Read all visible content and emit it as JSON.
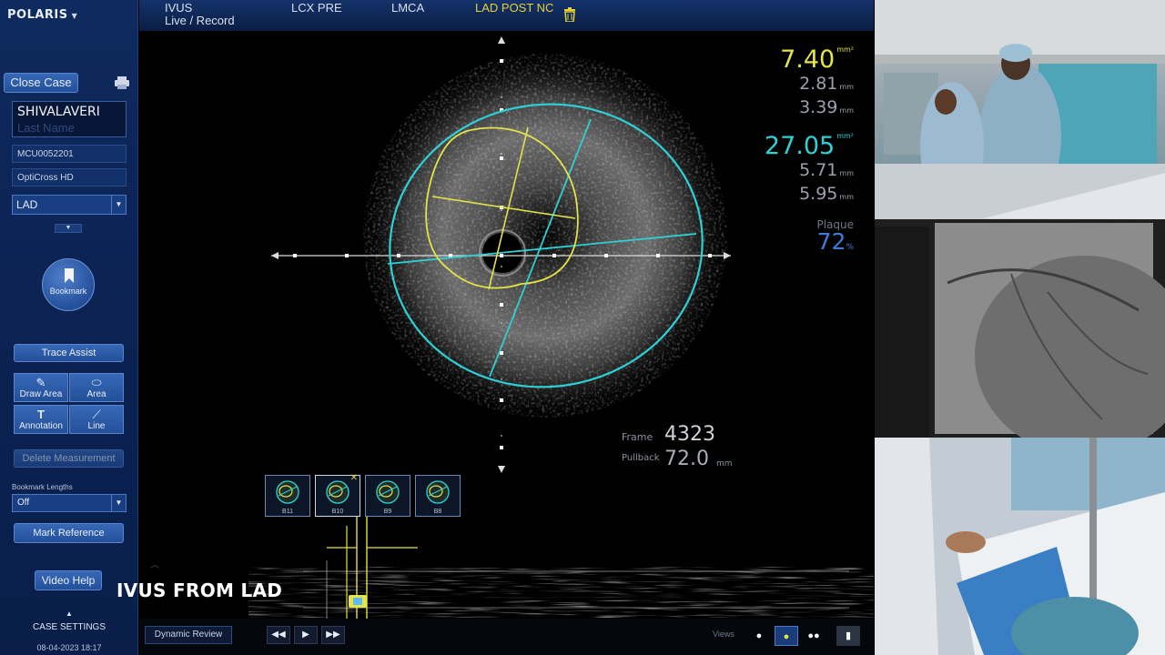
{
  "sidebar": {
    "brand": "POLARIS",
    "close_case": "Close Case",
    "patient_first": "SHIVALAVERI",
    "patient_last_placeholder": "Last Name",
    "patient_id": "MCU0052201",
    "catheter": "OptiCross HD",
    "vessel": "LAD",
    "bookmark": "Bookmark",
    "trace_assist": "Trace Assist",
    "tools": {
      "draw_area": "Draw Area",
      "area": "Area",
      "annotation": "Annotation",
      "line": "Line"
    },
    "delete_measurement": "Delete Measurement",
    "bookmark_lengths_label": "Bookmark Lengths",
    "bookmark_lengths_value": "Off",
    "mark_reference": "Mark Reference",
    "video_help": "Video Help",
    "case_settings": "CASE SETTINGS",
    "datetime": "08-04-2023 18:17"
  },
  "tabs": [
    {
      "line1": "IVUS",
      "line2": "Live / Record"
    },
    {
      "label": "LCX PRE"
    },
    {
      "label": "LMCA"
    },
    {
      "label": "LAD POST NC",
      "active": true
    }
  ],
  "measurements": {
    "lumen": {
      "area": "7.40",
      "area_unit": "mm²",
      "d1": "2.81",
      "d2": "3.39",
      "d_unit": "mm",
      "color": "#e3e34a"
    },
    "vessel": {
      "area": "27.05",
      "area_unit": "mm²",
      "d1": "5.71",
      "d2": "5.95",
      "d_unit": "mm",
      "color": "#2fd0d4"
    },
    "plaque_label": "Plaque",
    "plaque_value": "72",
    "plaque_unit": "%",
    "plaque_color": "#3d7dd8"
  },
  "frame": {
    "frame_label": "Frame",
    "frame_value": "4323",
    "pullback_label": "Pullback",
    "pullback_value": "72.0",
    "pullback_unit": "mm"
  },
  "thumbnails": [
    "B11",
    "B10",
    "B9",
    "B8"
  ],
  "caption": "IVUS FROM LAD",
  "bottom": {
    "dynamic_review": "Dynamic Review",
    "views": "Views"
  },
  "colors": {
    "accent": "#e5d13a",
    "sidebar": "#0f2a5e",
    "vessel": "#2fd0d4",
    "lumen": "#e3e34a"
  }
}
